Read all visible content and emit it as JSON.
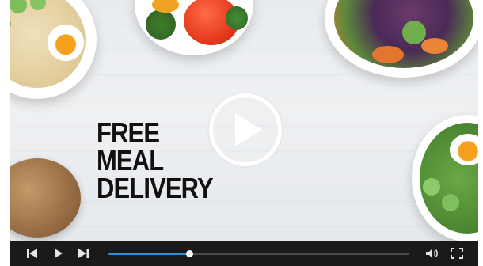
{
  "video": {
    "headline": [
      "FREE",
      "MEAL",
      "DELIVERY"
    ],
    "progress": 0.27
  },
  "icons": {
    "play_overlay": "play-circle-icon",
    "skip_back": "skip-back-icon",
    "play": "play-icon",
    "skip_forward": "skip-forward-icon",
    "volume": "volume-icon",
    "fullscreen": "fullscreen-icon"
  },
  "colors": {
    "progress_fill": "#2a8fd4",
    "control_bar": "#1a1a1a"
  }
}
